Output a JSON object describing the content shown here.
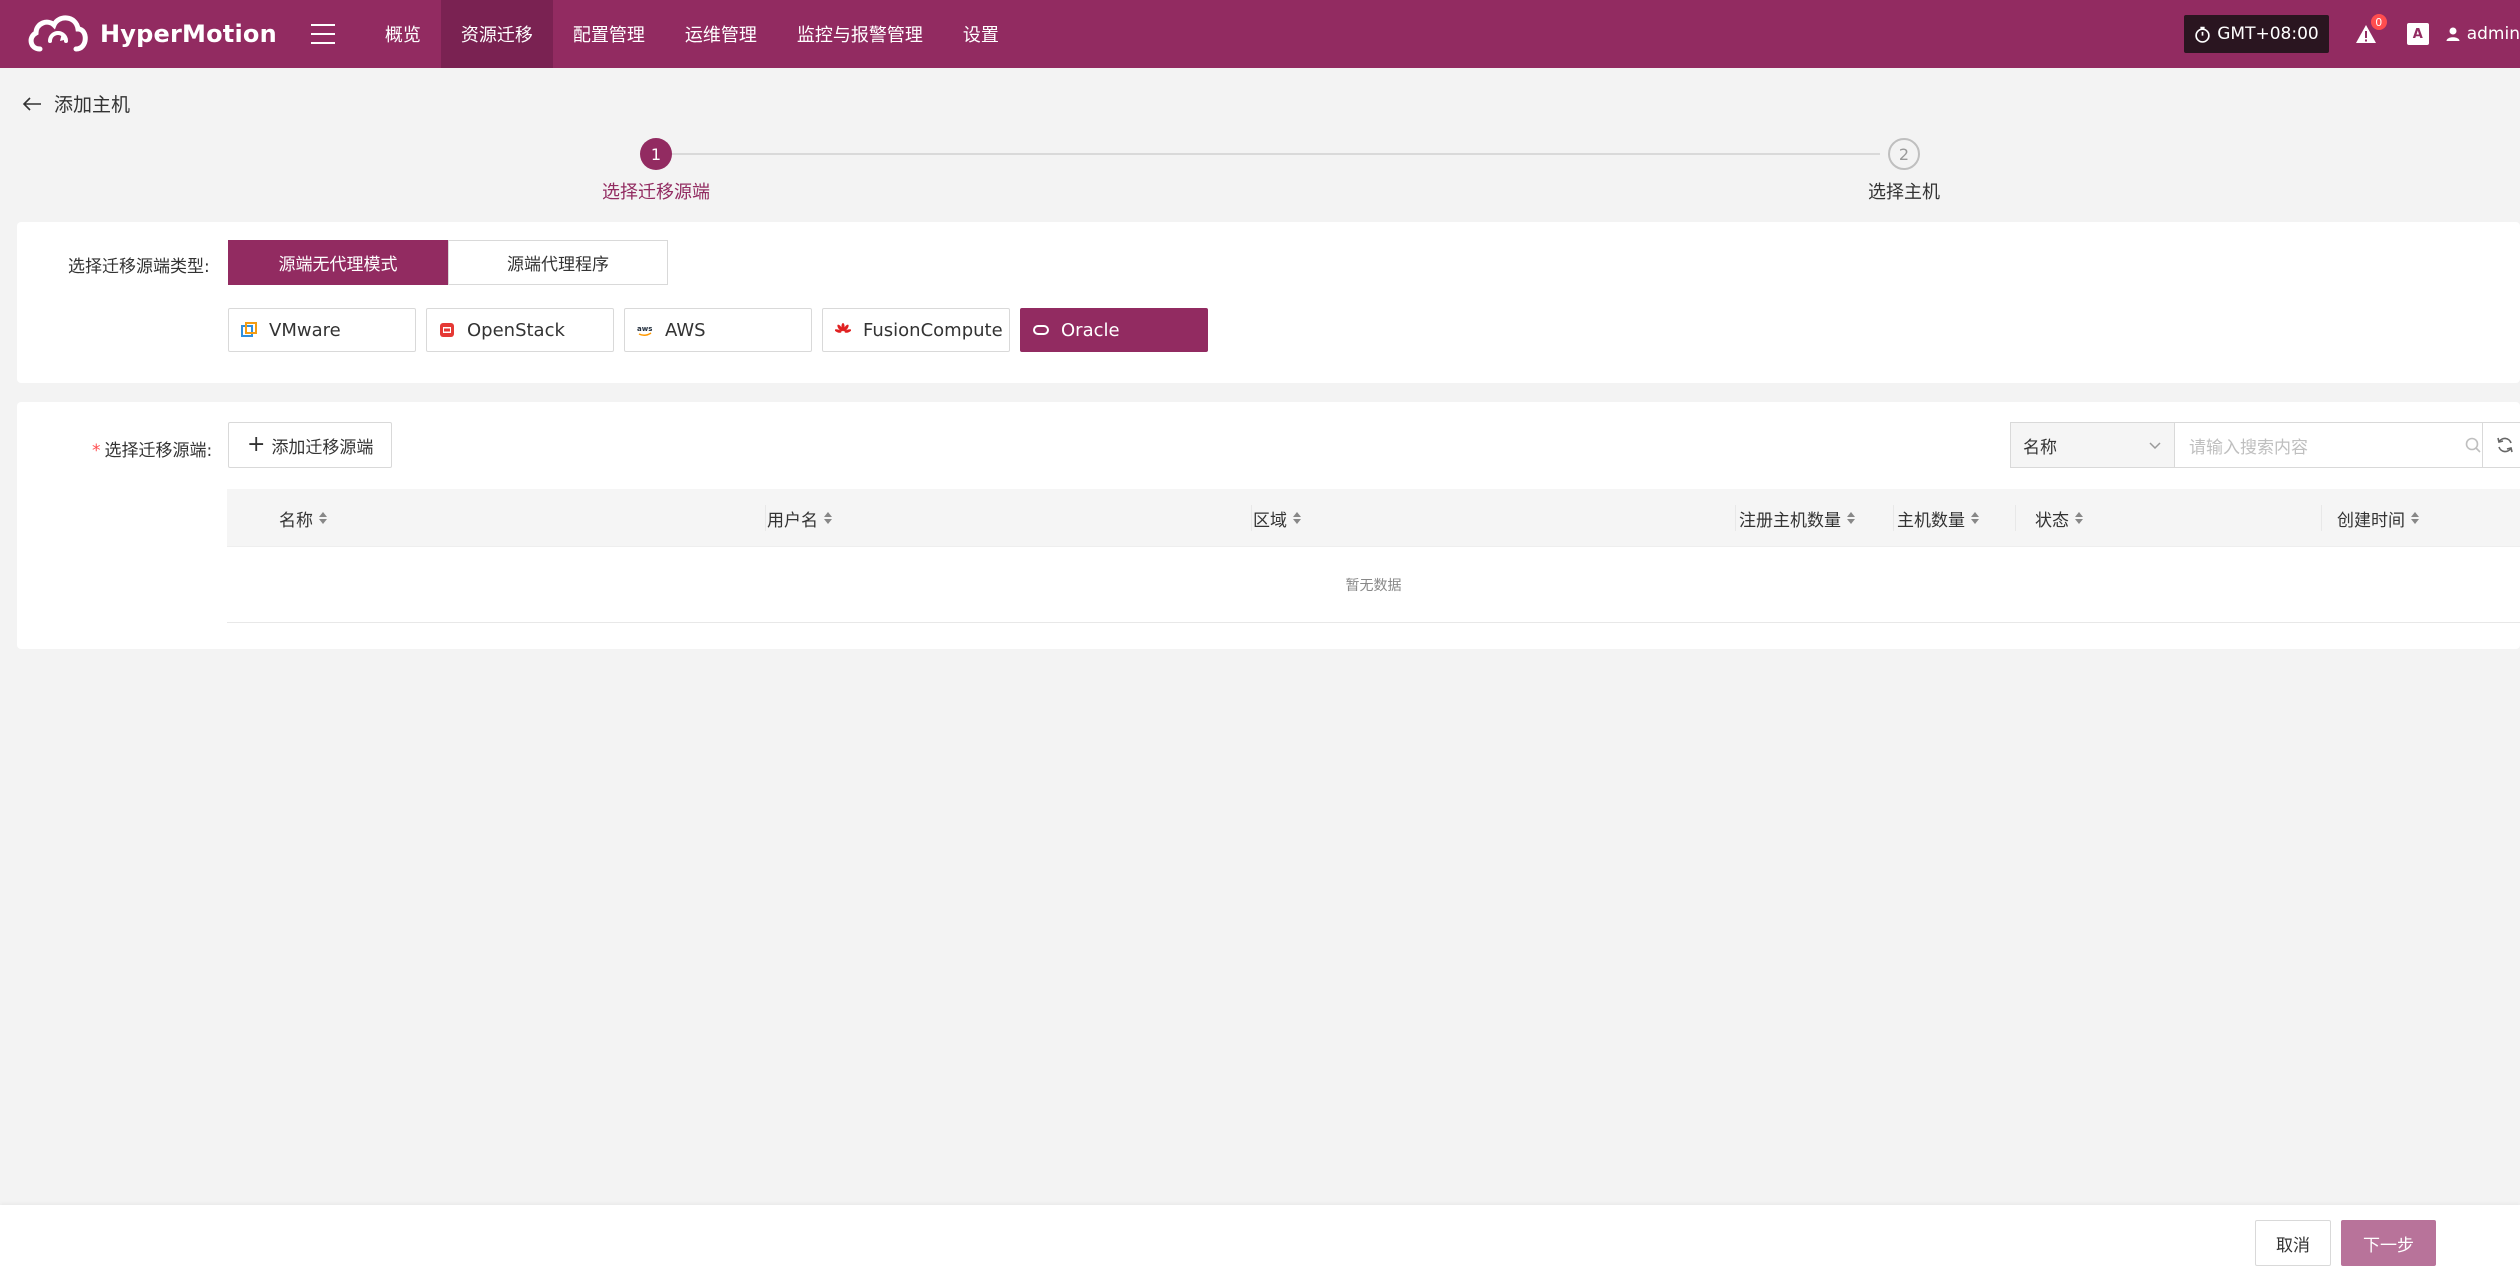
{
  "app": {
    "name": "HyperMotion",
    "nav": [
      {
        "label": "概览",
        "active": false
      },
      {
        "label": "资源迁移",
        "active": true
      },
      {
        "label": "配置管理",
        "active": false
      },
      {
        "label": "运维管理",
        "active": false
      },
      {
        "label": "监控与报警管理",
        "active": false
      },
      {
        "label": "设置",
        "active": false
      }
    ],
    "timezone": "GMT+08:00",
    "alert_count": "0",
    "lang_icon_text": "A",
    "user": "admin"
  },
  "page": {
    "title": "添加主机"
  },
  "steps": [
    {
      "number": "1",
      "label": "选择迁移源端",
      "status": "active"
    },
    {
      "number": "2",
      "label": "选择主机",
      "status": "pending"
    }
  ],
  "source_type": {
    "label": "选择迁移源端类型:",
    "modes": [
      {
        "label": "源端无代理模式",
        "active": true
      },
      {
        "label": "源端代理程序",
        "active": false
      }
    ],
    "platforms": [
      {
        "label": "VMware",
        "icon": "vmware-icon",
        "active": false
      },
      {
        "label": "OpenStack",
        "icon": "openstack-icon",
        "active": false
      },
      {
        "label": "AWS",
        "icon": "aws-icon",
        "active": false
      },
      {
        "label": "FusionCompute",
        "icon": "huawei-icon",
        "active": false
      },
      {
        "label": "Oracle",
        "icon": "oracle-icon",
        "active": true
      }
    ]
  },
  "source_select": {
    "required_mark": "*",
    "label": "选择迁移源端:",
    "add_button": "添加迁移源端",
    "search": {
      "field_selected": "名称",
      "placeholder": "请输入搜索内容"
    },
    "table": {
      "columns": [
        "名称",
        "用户名",
        "区域",
        "注册主机数量",
        "主机数量",
        "状态",
        "创建时间"
      ],
      "rows": [],
      "empty_text": "暂无数据"
    }
  },
  "footer": {
    "cancel": "取消",
    "next": "下一步"
  },
  "colors": {
    "brand": "#922b61",
    "brand_dark": "#7a2252",
    "next_button": "#b8739a"
  }
}
